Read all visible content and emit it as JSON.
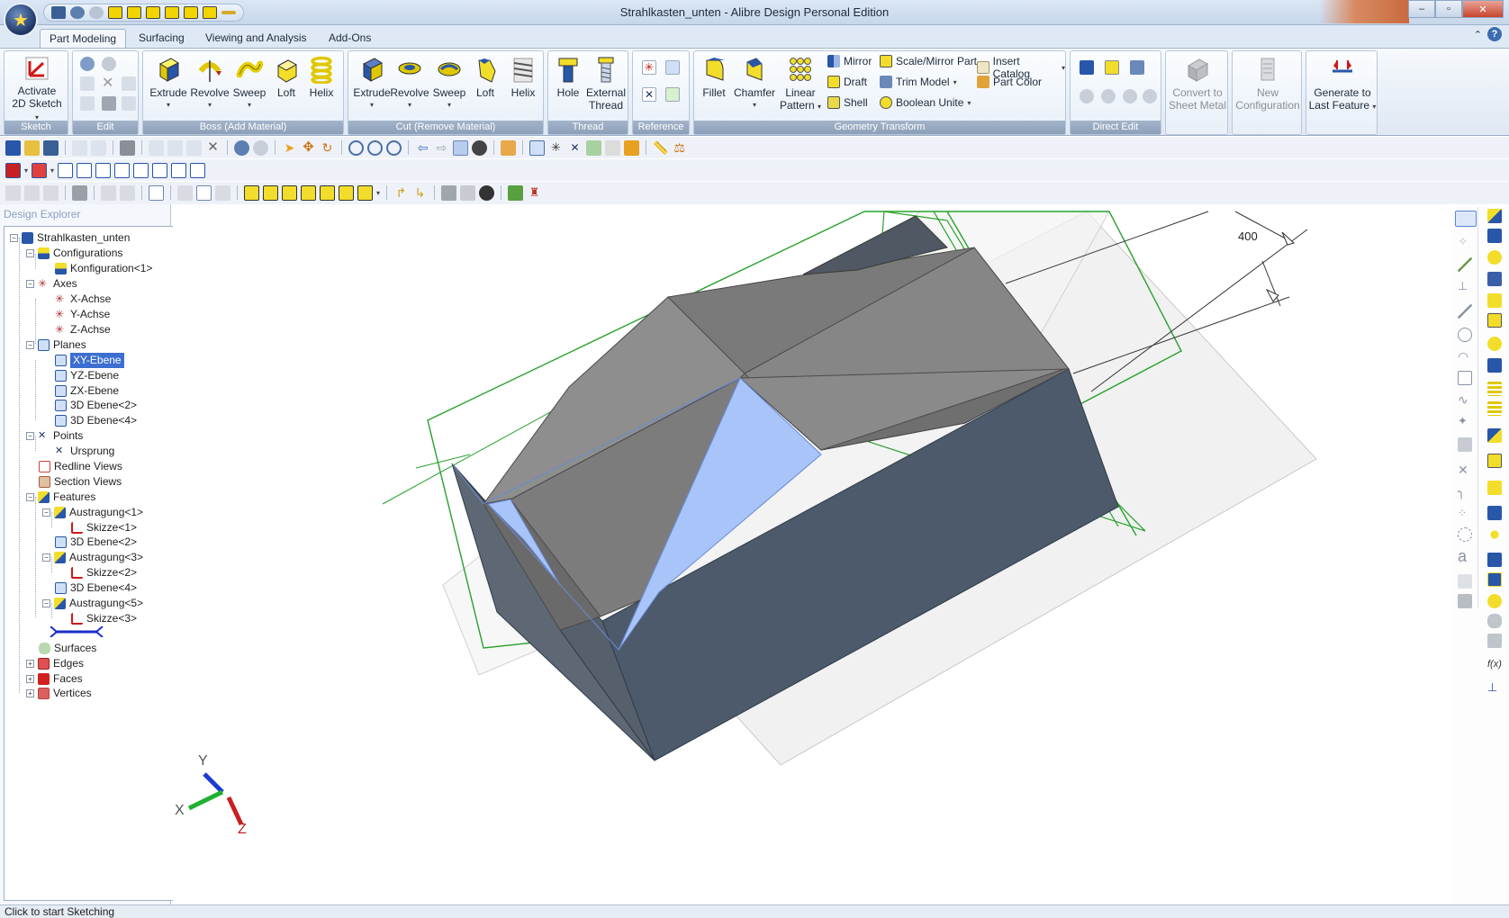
{
  "window": {
    "title": "Strahlkasten_unten - Alibre Design Personal Edition",
    "controls": {
      "minimize": "–",
      "maximize": "▫",
      "close": "✕"
    }
  },
  "ribbon_tabs": [
    "Part Modeling",
    "Surfacing",
    "Viewing and Analysis",
    "Add-Ons"
  ],
  "active_tab": "Part Modeling",
  "ribbon": {
    "sketch": {
      "label": "Sketch",
      "activate": "Activate",
      "activate2": "2D Sketch"
    },
    "edit": {
      "label": "Edit"
    },
    "boss": {
      "label": "Boss (Add Material)",
      "extrude": "Extrude",
      "revolve": "Revolve",
      "sweep": "Sweep",
      "loft": "Loft",
      "helix": "Helix"
    },
    "cut": {
      "label": "Cut (Remove Material)",
      "extrude": "Extrude",
      "revolve": "Revolve",
      "sweep": "Sweep",
      "loft": "Loft",
      "helix": "Helix"
    },
    "thread": {
      "label": "Thread",
      "hole": "Hole",
      "external": "External",
      "external2": "Thread"
    },
    "reference": {
      "label": "Reference"
    },
    "geometry": {
      "label": "Geometry Transform",
      "fillet": "Fillet",
      "chamfer": "Chamfer",
      "linear": "Linear",
      "linear2": "Pattern",
      "mirror": "Mirror",
      "draft": "Draft",
      "shell": "Shell",
      "scale_mirror": "Scale/Mirror Part",
      "trim": "Trim Model",
      "boolean": "Boolean Unite",
      "insert_catalog": "Insert Catalog",
      "part_color": "Part Color"
    },
    "direct_edit": {
      "label": "Direct Edit"
    },
    "convert": {
      "l1": "Convert to",
      "l2": "Sheet Metal"
    },
    "new_config": {
      "l1": "New",
      "l2": "Configuration"
    },
    "generate": {
      "l1": "Generate to",
      "l2": "Last Feature"
    }
  },
  "explorer": {
    "title": "Design Explorer",
    "root": "Strahlkasten_unten",
    "configurations": "Configurations",
    "konfig": "Konfiguration<1>",
    "axes": "Axes",
    "x_achse": "X-Achse",
    "y_achse": "Y-Achse",
    "z_achse": "Z-Achse",
    "planes": "Planes",
    "xy": "XY-Ebene",
    "yz": "YZ-Ebene",
    "zx": "ZX-Ebene",
    "e2": "3D Ebene<2>",
    "e4": "3D Ebene<4>",
    "points": "Points",
    "ursprung": "Ursprung",
    "redline": "Redline Views",
    "section": "Section Views",
    "features": "Features",
    "a1": "Austragung<1>",
    "s1": "Skizze<1>",
    "f_e2": "3D Ebene<2>",
    "a3": "Austragung<3>",
    "s2": "Skizze<2>",
    "f_e4": "3D Ebene<4>",
    "a5": "Austragung<5>",
    "s3": "Skizze<3>",
    "surfaces": "Surfaces",
    "edges": "Edges",
    "faces": "Faces",
    "vertices": "Vertices"
  },
  "viewport": {
    "dimension_label": "400",
    "axis_x": "X",
    "axis_y": "Y",
    "axis_z": "Z"
  },
  "status": "Click to start Sketching",
  "colors": {
    "accent": "#3c6fd1",
    "model_face": "#4c5a6b",
    "model_top": "#8c8c8c",
    "selected_face": "#a8c4f8",
    "plane_green": "#27a12b"
  }
}
